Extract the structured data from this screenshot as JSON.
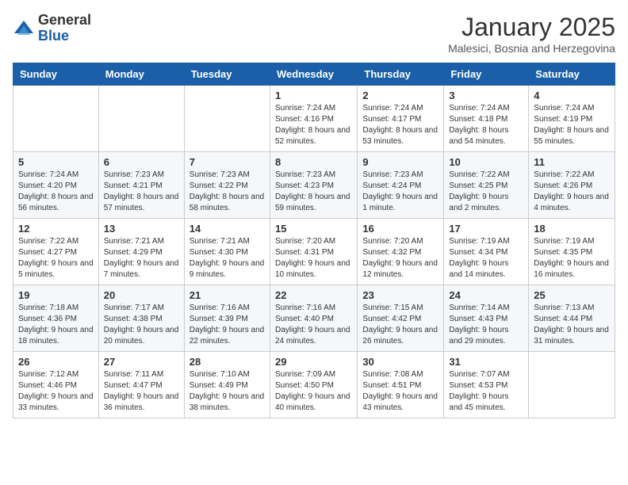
{
  "logo": {
    "general": "General",
    "blue": "Blue"
  },
  "header": {
    "month": "January 2025",
    "location": "Malesici, Bosnia and Herzegovina"
  },
  "weekdays": [
    "Sunday",
    "Monday",
    "Tuesday",
    "Wednesday",
    "Thursday",
    "Friday",
    "Saturday"
  ],
  "weeks": [
    [
      {
        "day": "",
        "info": ""
      },
      {
        "day": "",
        "info": ""
      },
      {
        "day": "",
        "info": ""
      },
      {
        "day": "1",
        "info": "Sunrise: 7:24 AM\nSunset: 4:16 PM\nDaylight: 8 hours and 52 minutes."
      },
      {
        "day": "2",
        "info": "Sunrise: 7:24 AM\nSunset: 4:17 PM\nDaylight: 8 hours and 53 minutes."
      },
      {
        "day": "3",
        "info": "Sunrise: 7:24 AM\nSunset: 4:18 PM\nDaylight: 8 hours and 54 minutes."
      },
      {
        "day": "4",
        "info": "Sunrise: 7:24 AM\nSunset: 4:19 PM\nDaylight: 8 hours and 55 minutes."
      }
    ],
    [
      {
        "day": "5",
        "info": "Sunrise: 7:24 AM\nSunset: 4:20 PM\nDaylight: 8 hours and 56 minutes."
      },
      {
        "day": "6",
        "info": "Sunrise: 7:23 AM\nSunset: 4:21 PM\nDaylight: 8 hours and 57 minutes."
      },
      {
        "day": "7",
        "info": "Sunrise: 7:23 AM\nSunset: 4:22 PM\nDaylight: 8 hours and 58 minutes."
      },
      {
        "day": "8",
        "info": "Sunrise: 7:23 AM\nSunset: 4:23 PM\nDaylight: 8 hours and 59 minutes."
      },
      {
        "day": "9",
        "info": "Sunrise: 7:23 AM\nSunset: 4:24 PM\nDaylight: 9 hours and 1 minute."
      },
      {
        "day": "10",
        "info": "Sunrise: 7:22 AM\nSunset: 4:25 PM\nDaylight: 9 hours and 2 minutes."
      },
      {
        "day": "11",
        "info": "Sunrise: 7:22 AM\nSunset: 4:26 PM\nDaylight: 9 hours and 4 minutes."
      }
    ],
    [
      {
        "day": "12",
        "info": "Sunrise: 7:22 AM\nSunset: 4:27 PM\nDaylight: 9 hours and 5 minutes."
      },
      {
        "day": "13",
        "info": "Sunrise: 7:21 AM\nSunset: 4:29 PM\nDaylight: 9 hours and 7 minutes."
      },
      {
        "day": "14",
        "info": "Sunrise: 7:21 AM\nSunset: 4:30 PM\nDaylight: 9 hours and 9 minutes."
      },
      {
        "day": "15",
        "info": "Sunrise: 7:20 AM\nSunset: 4:31 PM\nDaylight: 9 hours and 10 minutes."
      },
      {
        "day": "16",
        "info": "Sunrise: 7:20 AM\nSunset: 4:32 PM\nDaylight: 9 hours and 12 minutes."
      },
      {
        "day": "17",
        "info": "Sunrise: 7:19 AM\nSunset: 4:34 PM\nDaylight: 9 hours and 14 minutes."
      },
      {
        "day": "18",
        "info": "Sunrise: 7:19 AM\nSunset: 4:35 PM\nDaylight: 9 hours and 16 minutes."
      }
    ],
    [
      {
        "day": "19",
        "info": "Sunrise: 7:18 AM\nSunset: 4:36 PM\nDaylight: 9 hours and 18 minutes."
      },
      {
        "day": "20",
        "info": "Sunrise: 7:17 AM\nSunset: 4:38 PM\nDaylight: 9 hours and 20 minutes."
      },
      {
        "day": "21",
        "info": "Sunrise: 7:16 AM\nSunset: 4:39 PM\nDaylight: 9 hours and 22 minutes."
      },
      {
        "day": "22",
        "info": "Sunrise: 7:16 AM\nSunset: 4:40 PM\nDaylight: 9 hours and 24 minutes."
      },
      {
        "day": "23",
        "info": "Sunrise: 7:15 AM\nSunset: 4:42 PM\nDaylight: 9 hours and 26 minutes."
      },
      {
        "day": "24",
        "info": "Sunrise: 7:14 AM\nSunset: 4:43 PM\nDaylight: 9 hours and 29 minutes."
      },
      {
        "day": "25",
        "info": "Sunrise: 7:13 AM\nSunset: 4:44 PM\nDaylight: 9 hours and 31 minutes."
      }
    ],
    [
      {
        "day": "26",
        "info": "Sunrise: 7:12 AM\nSunset: 4:46 PM\nDaylight: 9 hours and 33 minutes."
      },
      {
        "day": "27",
        "info": "Sunrise: 7:11 AM\nSunset: 4:47 PM\nDaylight: 9 hours and 36 minutes."
      },
      {
        "day": "28",
        "info": "Sunrise: 7:10 AM\nSunset: 4:49 PM\nDaylight: 9 hours and 38 minutes."
      },
      {
        "day": "29",
        "info": "Sunrise: 7:09 AM\nSunset: 4:50 PM\nDaylight: 9 hours and 40 minutes."
      },
      {
        "day": "30",
        "info": "Sunrise: 7:08 AM\nSunset: 4:51 PM\nDaylight: 9 hours and 43 minutes."
      },
      {
        "day": "31",
        "info": "Sunrise: 7:07 AM\nSunset: 4:53 PM\nDaylight: 9 hours and 45 minutes."
      },
      {
        "day": "",
        "info": ""
      }
    ]
  ]
}
